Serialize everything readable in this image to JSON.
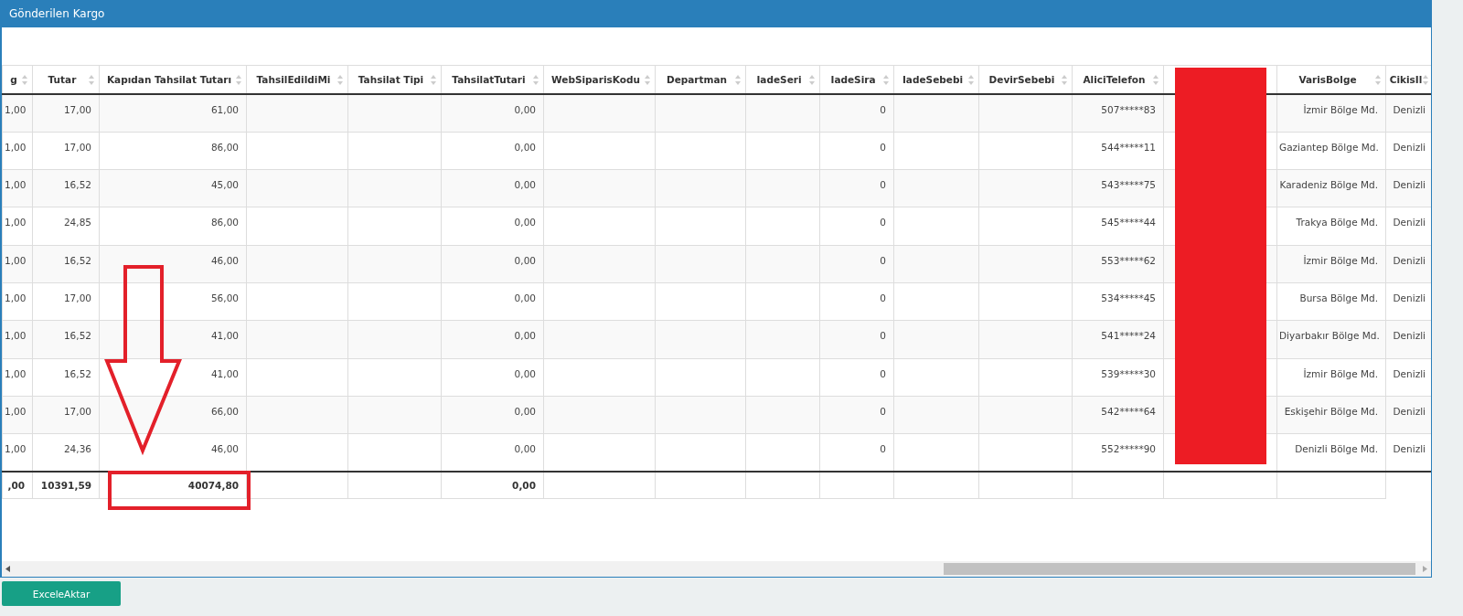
{
  "window": {
    "title": "Gönderilen Kargo"
  },
  "table": {
    "columns": [
      {
        "label": "g",
        "footer_cell": true,
        "total": ",00"
      },
      {
        "label": "Tutar",
        "footer_cell": true,
        "total": "10391,59"
      },
      {
        "label": "Kapıdan Tahsilat Tutarı",
        "footer_cell": true,
        "total": "40074,80"
      },
      {
        "label": "TahsilEdildiMi",
        "footer_cell": true
      },
      {
        "label": "Tahsilat Tipi",
        "footer_cell": true
      },
      {
        "label": "TahsilatTutari",
        "footer_cell": true,
        "total": "0,00"
      },
      {
        "label": "WebSiparisKodu",
        "footer_cell": true
      },
      {
        "label": "Departman",
        "footer_cell": true
      },
      {
        "label": "IadeSeri",
        "footer_cell": true
      },
      {
        "label": "IadeSira",
        "footer_cell": true
      },
      {
        "label": "IadeSebebi",
        "footer_cell": true
      },
      {
        "label": "DevirSebebi",
        "footer_cell": true
      },
      {
        "label": "AliciTelefon",
        "footer_cell": true
      },
      {
        "kind": "hidden",
        "footer_cell": true
      },
      {
        "label": "VarisBolge",
        "footer_cell": true
      },
      {
        "label": "CikisIl",
        "footer_cell": false
      }
    ],
    "rows": [
      [
        "1,00",
        "17,00",
        "61,00",
        null,
        null,
        "0,00",
        null,
        null,
        null,
        "0",
        null,
        null,
        "507*****83",
        null,
        "İzmir Bölge Md.",
        "Denizli"
      ],
      [
        "1,00",
        "17,00",
        "86,00",
        null,
        null,
        "0,00",
        null,
        null,
        null,
        "0",
        null,
        null,
        "544*****11",
        null,
        "Gaziantep Bölge Md.",
        "Denizli"
      ],
      [
        "1,00",
        "16,52",
        "45,00",
        null,
        null,
        "0,00",
        null,
        null,
        null,
        "0",
        null,
        null,
        "543*****75",
        null,
        "Karadeniz Bölge Md.",
        "Denizli"
      ],
      [
        "1,00",
        "24,85",
        "86,00",
        null,
        null,
        "0,00",
        null,
        null,
        null,
        "0",
        null,
        null,
        "545*****44",
        null,
        "Trakya Bölge Md.",
        "Denizli"
      ],
      [
        "1,00",
        "16,52",
        "46,00",
        null,
        null,
        "0,00",
        null,
        null,
        null,
        "0",
        null,
        null,
        "553*****62",
        null,
        "İzmir Bölge Md.",
        "Denizli"
      ],
      [
        "1,00",
        "17,00",
        "56,00",
        null,
        null,
        "0,00",
        null,
        null,
        null,
        "0",
        null,
        null,
        "534*****45",
        null,
        "Bursa Bölge Md.",
        "Denizli"
      ],
      [
        "1,00",
        "16,52",
        "41,00",
        null,
        null,
        "0,00",
        null,
        null,
        null,
        "0",
        null,
        null,
        "541*****24",
        null,
        "Diyarbakır Bölge Md.",
        "Denizli"
      ],
      [
        "1,00",
        "16,52",
        "41,00",
        null,
        null,
        "0,00",
        null,
        null,
        null,
        "0",
        null,
        null,
        "539*****30",
        null,
        "İzmir Bölge Md.",
        "Denizli"
      ],
      [
        "1,00",
        "17,00",
        "66,00",
        null,
        null,
        "0,00",
        null,
        null,
        null,
        "0",
        null,
        null,
        "542*****64",
        null,
        "Eskişehir Bölge Md.",
        "Denizli"
      ],
      [
        "1,00",
        "24,36",
        "46,00",
        null,
        null,
        "0,00",
        null,
        null,
        null,
        "0",
        null,
        null,
        "552*****90",
        null,
        "Denizli Bölge Md.",
        "Denizli"
      ]
    ]
  },
  "annotations": [
    {
      "kind": "redaction"
    },
    {
      "kind": "arrow"
    },
    {
      "kind": "highlight_box"
    }
  ],
  "buttons": [
    {
      "label": "ExceleAktar"
    }
  ]
}
